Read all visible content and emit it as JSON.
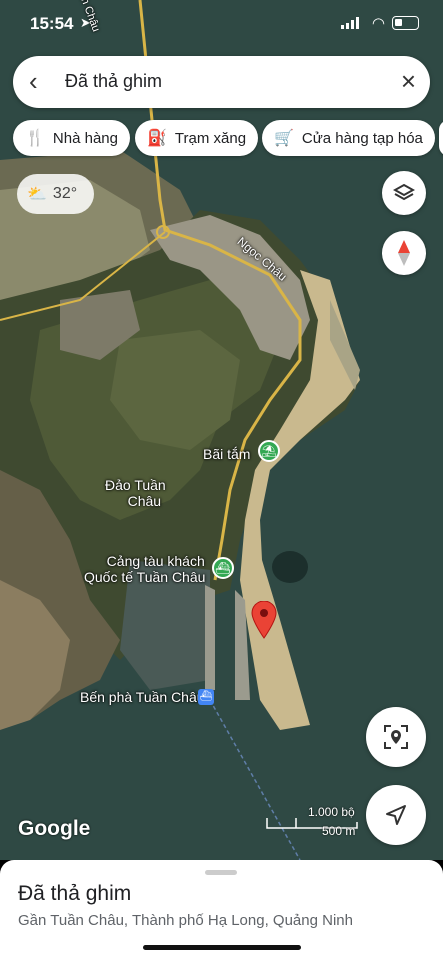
{
  "status_bar": {
    "time": "15:54"
  },
  "search": {
    "query": "Đã thả ghim"
  },
  "chips": [
    {
      "label": "Nhà hàng",
      "icon": "restaurant-icon"
    },
    {
      "label": "Trạm xăng",
      "icon": "gas-station-icon"
    },
    {
      "label": "Cửa hàng tạp hóa",
      "icon": "cart-icon"
    }
  ],
  "weather": {
    "temp": "32°",
    "icon": "partly-cloudy-icon"
  },
  "map_labels": {
    "road": "Ngọc Châu",
    "beach": "Bãi tắm",
    "island_line1": "Đảo Tuần",
    "island_line2": "Châu",
    "port_line1": "Cảng tàu khách",
    "port_line2": "Quốc tế Tuần Châu",
    "ferry": "Bến phà Tuần Châu",
    "road_top": "Tuần Châu"
  },
  "scale": {
    "upper": "1.000 bộ",
    "lower": "500 m"
  },
  "attribution": "Google",
  "colors": {
    "water": "#2f4a44",
    "pin": "#ea4335",
    "poi_green": "#34a853",
    "ferry_blue": "#4285f4"
  },
  "place": {
    "title": "Đã thả ghim",
    "subtitle": "Gần Tuần Châu, Thành phố Hạ Long, Quảng Ninh"
  }
}
